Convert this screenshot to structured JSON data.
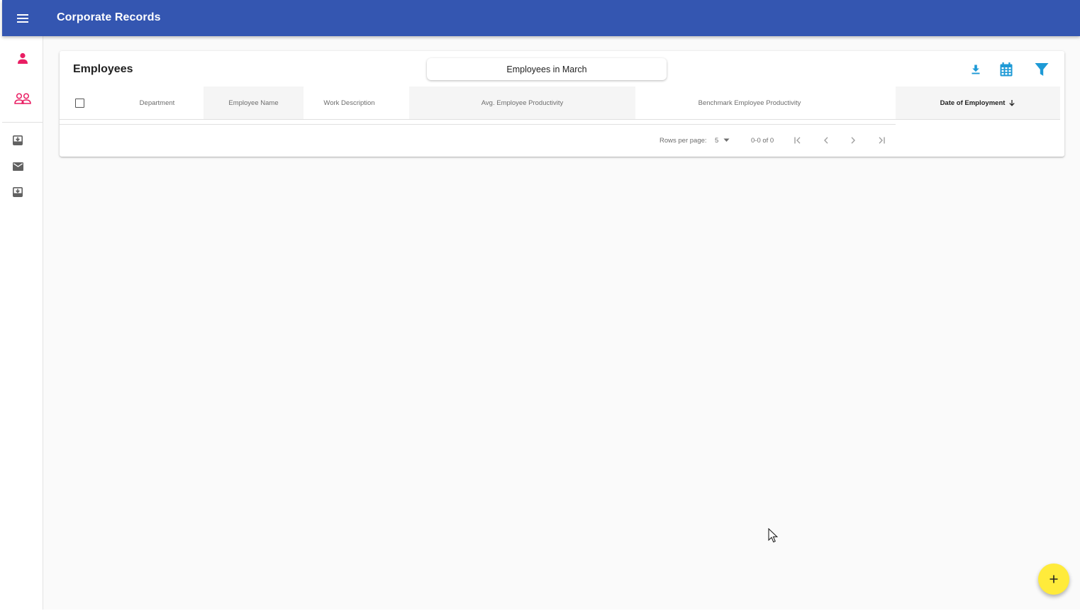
{
  "app": {
    "title": "Corporate Records"
  },
  "sidebar": {
    "items": [
      {
        "icon": "person-icon",
        "color": "#e91e63"
      },
      {
        "icon": "people-icon",
        "color": "#e91e63"
      },
      {
        "icon": "move-to-inbox-icon",
        "color": "#616161"
      },
      {
        "icon": "mail-icon",
        "color": "#616161"
      },
      {
        "icon": "move-to-inbox-icon",
        "color": "#616161"
      }
    ]
  },
  "card": {
    "title": "Employees",
    "filter_label": "Employees in March",
    "toolbar": [
      {
        "icon": "download-icon"
      },
      {
        "icon": "calendar-icon"
      },
      {
        "icon": "filter-icon"
      }
    ],
    "columns": [
      "Department",
      "Employee Name",
      "Work Description",
      "Avg. Employee Productivity",
      "Benchmark Employee Productivity",
      "Date of Employment"
    ],
    "sorted_column": "Date of Employment",
    "sort_direction": "descending",
    "pagination": {
      "rows_per_page_label": "Rows per page:",
      "rows_per_page": "5",
      "range_label": "0-0 of 0"
    }
  },
  "fab": {
    "icon": "add-icon"
  },
  "colors": {
    "appbar": "#3456b1",
    "accent_pink": "#e91e63",
    "tool_blue": "#1e9ad6",
    "fab_yellow": "#ffeb3b"
  }
}
